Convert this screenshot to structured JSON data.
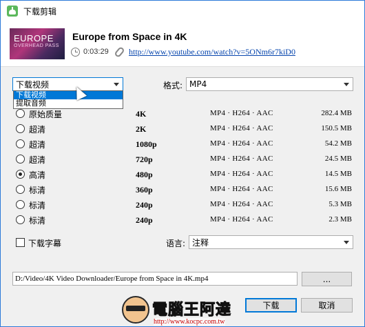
{
  "window": {
    "title": "下载剪辑"
  },
  "video": {
    "thumbnail_title": "EUROPE",
    "thumbnail_subtitle": "OVERHEAD PASS",
    "title": "Europe from Space in 4K",
    "duration": "0:03:29",
    "url": "http://www.youtube.com/watch?v=5ONm6r7kiD0"
  },
  "download_type": {
    "selected": "下载视频",
    "options": [
      "下载视频",
      "提取音频"
    ]
  },
  "format": {
    "label": "格式:",
    "value": "MP4"
  },
  "qualities": [
    {
      "label": "原始质量",
      "resolution": "4K",
      "format": "MP4 · H264 · AAC",
      "size": "282.4 MB",
      "checked": false
    },
    {
      "label": "超清",
      "resolution": "2K",
      "format": "MP4 · H264 · AAC",
      "size": "150.5 MB",
      "checked": false
    },
    {
      "label": "超清",
      "resolution": "1080p",
      "format": "MP4 · H264 · AAC",
      "size": "54.2 MB",
      "checked": false
    },
    {
      "label": "超清",
      "resolution": "720p",
      "format": "MP4 · H264 · AAC",
      "size": "24.5 MB",
      "checked": false
    },
    {
      "label": "高清",
      "resolution": "480p",
      "format": "MP4 · H264 · AAC",
      "size": "14.5 MB",
      "checked": true
    },
    {
      "label": "标清",
      "resolution": "360p",
      "format": "MP4 · H264 · AAC",
      "size": "15.6 MB",
      "checked": false
    },
    {
      "label": "标清",
      "resolution": "240p",
      "format": "MP4 · H264 · AAC",
      "size": "5.3 MB",
      "checked": false
    },
    {
      "label": "标清",
      "resolution": "240p",
      "format": "MP4 · H264 · AAC",
      "size": "2.3 MB",
      "checked": false
    }
  ],
  "subtitles": {
    "checkbox_label": "下载字幕",
    "language_label": "语言:",
    "language_value": "注释"
  },
  "output": {
    "path": "D:/Video/4K Video Downloader/Europe from Space in 4K.mp4",
    "browse_label": "..."
  },
  "buttons": {
    "download": "下载",
    "cancel": "取消"
  },
  "watermark": {
    "text": "電腦王阿達",
    "url": "http://www.kocpc.com.tw"
  }
}
